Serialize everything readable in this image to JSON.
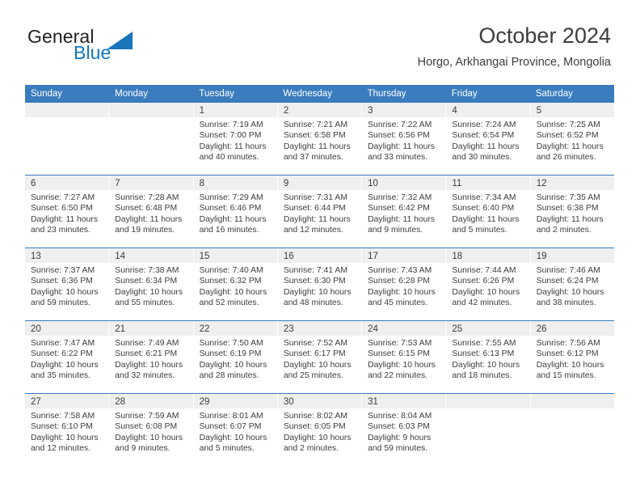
{
  "brand": {
    "name_part1": "General",
    "name_part2": "Blue",
    "accent_color": "#1b75bb",
    "triangle_icon": "triangle-icon"
  },
  "header": {
    "title": "October 2024",
    "subtitle": "Horgo, Arkhangai Province, Mongolia"
  },
  "calendar": {
    "header_bg": "#3a7cbe",
    "daynum_bg": "#efefef",
    "weekdays": [
      "Sunday",
      "Monday",
      "Tuesday",
      "Wednesday",
      "Thursday",
      "Friday",
      "Saturday"
    ],
    "weeks": [
      [
        {
          "day": "",
          "sunrise": "",
          "sunset": "",
          "daylight_line1": "",
          "daylight_line2": ""
        },
        {
          "day": "",
          "sunrise": "",
          "sunset": "",
          "daylight_line1": "",
          "daylight_line2": ""
        },
        {
          "day": "1",
          "sunrise": "Sunrise: 7:19 AM",
          "sunset": "Sunset: 7:00 PM",
          "daylight_line1": "Daylight: 11 hours",
          "daylight_line2": "and 40 minutes."
        },
        {
          "day": "2",
          "sunrise": "Sunrise: 7:21 AM",
          "sunset": "Sunset: 6:58 PM",
          "daylight_line1": "Daylight: 11 hours",
          "daylight_line2": "and 37 minutes."
        },
        {
          "day": "3",
          "sunrise": "Sunrise: 7:22 AM",
          "sunset": "Sunset: 6:56 PM",
          "daylight_line1": "Daylight: 11 hours",
          "daylight_line2": "and 33 minutes."
        },
        {
          "day": "4",
          "sunrise": "Sunrise: 7:24 AM",
          "sunset": "Sunset: 6:54 PM",
          "daylight_line1": "Daylight: 11 hours",
          "daylight_line2": "and 30 minutes."
        },
        {
          "day": "5",
          "sunrise": "Sunrise: 7:25 AM",
          "sunset": "Sunset: 6:52 PM",
          "daylight_line1": "Daylight: 11 hours",
          "daylight_line2": "and 26 minutes."
        }
      ],
      [
        {
          "day": "6",
          "sunrise": "Sunrise: 7:27 AM",
          "sunset": "Sunset: 6:50 PM",
          "daylight_line1": "Daylight: 11 hours",
          "daylight_line2": "and 23 minutes."
        },
        {
          "day": "7",
          "sunrise": "Sunrise: 7:28 AM",
          "sunset": "Sunset: 6:48 PM",
          "daylight_line1": "Daylight: 11 hours",
          "daylight_line2": "and 19 minutes."
        },
        {
          "day": "8",
          "sunrise": "Sunrise: 7:29 AM",
          "sunset": "Sunset: 6:46 PM",
          "daylight_line1": "Daylight: 11 hours",
          "daylight_line2": "and 16 minutes."
        },
        {
          "day": "9",
          "sunrise": "Sunrise: 7:31 AM",
          "sunset": "Sunset: 6:44 PM",
          "daylight_line1": "Daylight: 11 hours",
          "daylight_line2": "and 12 minutes."
        },
        {
          "day": "10",
          "sunrise": "Sunrise: 7:32 AM",
          "sunset": "Sunset: 6:42 PM",
          "daylight_line1": "Daylight: 11 hours",
          "daylight_line2": "and 9 minutes."
        },
        {
          "day": "11",
          "sunrise": "Sunrise: 7:34 AM",
          "sunset": "Sunset: 6:40 PM",
          "daylight_line1": "Daylight: 11 hours",
          "daylight_line2": "and 5 minutes."
        },
        {
          "day": "12",
          "sunrise": "Sunrise: 7:35 AM",
          "sunset": "Sunset: 6:38 PM",
          "daylight_line1": "Daylight: 11 hours",
          "daylight_line2": "and 2 minutes."
        }
      ],
      [
        {
          "day": "13",
          "sunrise": "Sunrise: 7:37 AM",
          "sunset": "Sunset: 6:36 PM",
          "daylight_line1": "Daylight: 10 hours",
          "daylight_line2": "and 59 minutes."
        },
        {
          "day": "14",
          "sunrise": "Sunrise: 7:38 AM",
          "sunset": "Sunset: 6:34 PM",
          "daylight_line1": "Daylight: 10 hours",
          "daylight_line2": "and 55 minutes."
        },
        {
          "day": "15",
          "sunrise": "Sunrise: 7:40 AM",
          "sunset": "Sunset: 6:32 PM",
          "daylight_line1": "Daylight: 10 hours",
          "daylight_line2": "and 52 minutes."
        },
        {
          "day": "16",
          "sunrise": "Sunrise: 7:41 AM",
          "sunset": "Sunset: 6:30 PM",
          "daylight_line1": "Daylight: 10 hours",
          "daylight_line2": "and 48 minutes."
        },
        {
          "day": "17",
          "sunrise": "Sunrise: 7:43 AM",
          "sunset": "Sunset: 6:28 PM",
          "daylight_line1": "Daylight: 10 hours",
          "daylight_line2": "and 45 minutes."
        },
        {
          "day": "18",
          "sunrise": "Sunrise: 7:44 AM",
          "sunset": "Sunset: 6:26 PM",
          "daylight_line1": "Daylight: 10 hours",
          "daylight_line2": "and 42 minutes."
        },
        {
          "day": "19",
          "sunrise": "Sunrise: 7:46 AM",
          "sunset": "Sunset: 6:24 PM",
          "daylight_line1": "Daylight: 10 hours",
          "daylight_line2": "and 38 minutes."
        }
      ],
      [
        {
          "day": "20",
          "sunrise": "Sunrise: 7:47 AM",
          "sunset": "Sunset: 6:22 PM",
          "daylight_line1": "Daylight: 10 hours",
          "daylight_line2": "and 35 minutes."
        },
        {
          "day": "21",
          "sunrise": "Sunrise: 7:49 AM",
          "sunset": "Sunset: 6:21 PM",
          "daylight_line1": "Daylight: 10 hours",
          "daylight_line2": "and 32 minutes."
        },
        {
          "day": "22",
          "sunrise": "Sunrise: 7:50 AM",
          "sunset": "Sunset: 6:19 PM",
          "daylight_line1": "Daylight: 10 hours",
          "daylight_line2": "and 28 minutes."
        },
        {
          "day": "23",
          "sunrise": "Sunrise: 7:52 AM",
          "sunset": "Sunset: 6:17 PM",
          "daylight_line1": "Daylight: 10 hours",
          "daylight_line2": "and 25 minutes."
        },
        {
          "day": "24",
          "sunrise": "Sunrise: 7:53 AM",
          "sunset": "Sunset: 6:15 PM",
          "daylight_line1": "Daylight: 10 hours",
          "daylight_line2": "and 22 minutes."
        },
        {
          "day": "25",
          "sunrise": "Sunrise: 7:55 AM",
          "sunset": "Sunset: 6:13 PM",
          "daylight_line1": "Daylight: 10 hours",
          "daylight_line2": "and 18 minutes."
        },
        {
          "day": "26",
          "sunrise": "Sunrise: 7:56 AM",
          "sunset": "Sunset: 6:12 PM",
          "daylight_line1": "Daylight: 10 hours",
          "daylight_line2": "and 15 minutes."
        }
      ],
      [
        {
          "day": "27",
          "sunrise": "Sunrise: 7:58 AM",
          "sunset": "Sunset: 6:10 PM",
          "daylight_line1": "Daylight: 10 hours",
          "daylight_line2": "and 12 minutes."
        },
        {
          "day": "28",
          "sunrise": "Sunrise: 7:59 AM",
          "sunset": "Sunset: 6:08 PM",
          "daylight_line1": "Daylight: 10 hours",
          "daylight_line2": "and 9 minutes."
        },
        {
          "day": "29",
          "sunrise": "Sunrise: 8:01 AM",
          "sunset": "Sunset: 6:07 PM",
          "daylight_line1": "Daylight: 10 hours",
          "daylight_line2": "and 5 minutes."
        },
        {
          "day": "30",
          "sunrise": "Sunrise: 8:02 AM",
          "sunset": "Sunset: 6:05 PM",
          "daylight_line1": "Daylight: 10 hours",
          "daylight_line2": "and 2 minutes."
        },
        {
          "day": "31",
          "sunrise": "Sunrise: 8:04 AM",
          "sunset": "Sunset: 6:03 PM",
          "daylight_line1": "Daylight: 9 hours",
          "daylight_line2": "and 59 minutes."
        },
        {
          "day": "",
          "sunrise": "",
          "sunset": "",
          "daylight_line1": "",
          "daylight_line2": ""
        },
        {
          "day": "",
          "sunrise": "",
          "sunset": "",
          "daylight_line1": "",
          "daylight_line2": ""
        }
      ]
    ]
  }
}
